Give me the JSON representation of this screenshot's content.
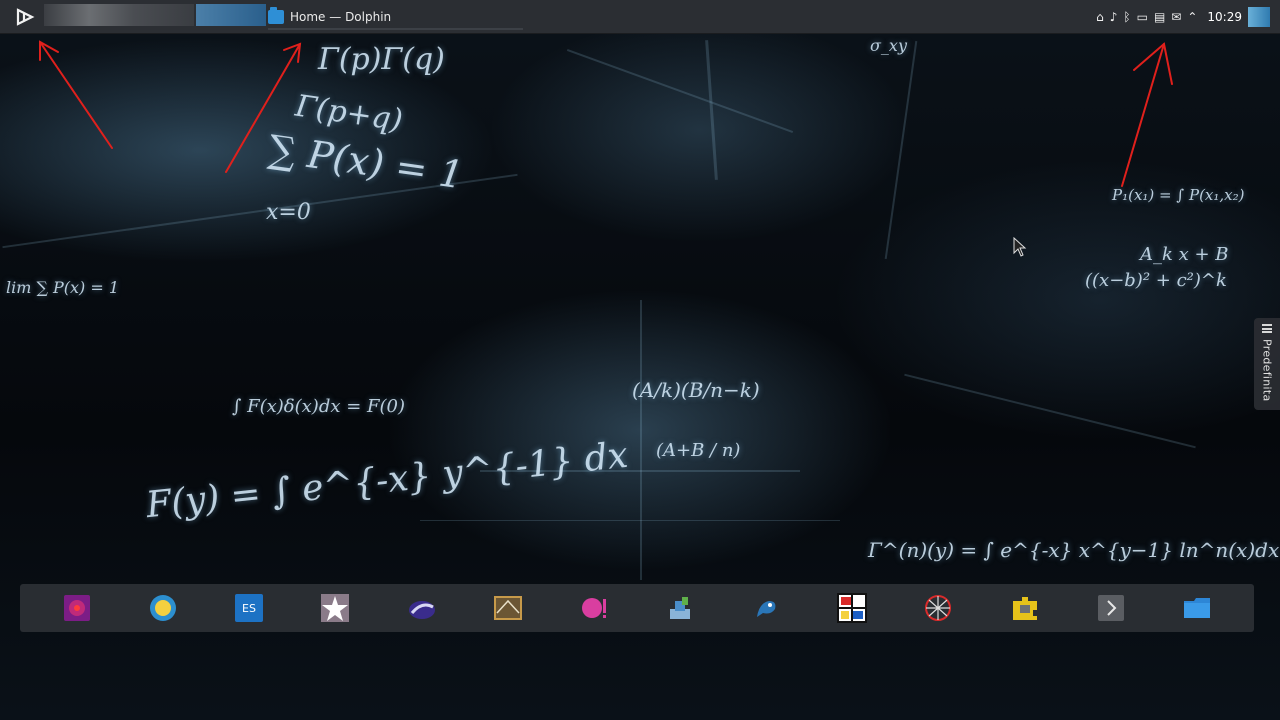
{
  "top_panel": {
    "launcher_icon": "kde-launcher-icon",
    "task": {
      "title": "Home — Dolphin",
      "icon": "folder-icon"
    },
    "tray_icons": [
      "network-icon",
      "volume-icon",
      "bluetooth-icon",
      "battery-icon",
      "clipboard-icon",
      "notifications-icon",
      "chevron-up-icon"
    ],
    "clock": "10:29"
  },
  "desktop": {
    "toolbox_label": "Predefinita",
    "wallpaper_formulas": [
      "Γ(p)Γ(q)",
      "Γ(p+q)",
      "∑ P(x) = 1",
      "x=0",
      "F(y) = ∫ e^{-x} y^{-1} dx",
      "∫ F(x)δ(x)dx = F(0)",
      "lim ∑ P(x) = 1",
      "σ_xy",
      "A_k x + B",
      "((x−b)² + c²)^k",
      "P₁(x₁) = ∫ P(x₁,x₂)",
      "Γ^(n)(y) = ∫ e^{-x} x^{y−1} ln^n(x)dx",
      "(A/k)(B/n−k)",
      "(A+B / n)"
    ]
  },
  "dock": {
    "items": [
      {
        "name": "kde-app-red-star-icon",
        "color": "#9b1a6e"
      },
      {
        "name": "kstars-sun-icon",
        "color": "#2c8fcf"
      },
      {
        "name": "kbruch-es-icon",
        "color": "#1d72c4"
      },
      {
        "name": "kstars-star-icon",
        "color": "#c7b7c9"
      },
      {
        "name": "telescope-app-icon",
        "color": "#3a2c8c"
      },
      {
        "name": "geometry-app-icon",
        "color": "#c79a4a"
      },
      {
        "name": "pink-app-icon",
        "color": "#d93ea0"
      },
      {
        "name": "bricks-app-icon",
        "color": "#4a8dc9"
      },
      {
        "name": "blue-creature-app-icon",
        "color": "#2a76b8"
      },
      {
        "name": "mondrian-app-icon",
        "color": "#ffffff"
      },
      {
        "name": "web-app-icon",
        "color": "#d92b2b"
      },
      {
        "name": "puzzle-app-icon",
        "color": "#e6c21a"
      },
      {
        "name": "chevron-right-icon",
        "color": "#5a5d62"
      },
      {
        "name": "folder-app-icon",
        "color": "#3a9ae8"
      }
    ]
  }
}
